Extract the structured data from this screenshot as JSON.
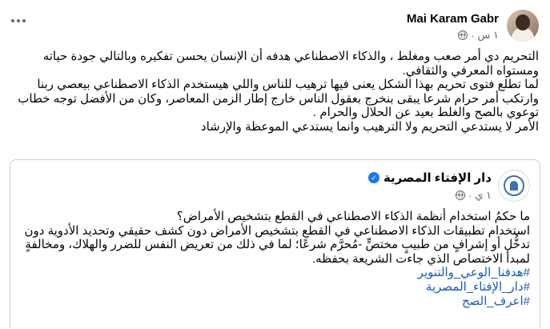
{
  "post": {
    "author": "Mai Karam Gabr",
    "time": "١ س",
    "more_icon": "ellipsis-icon",
    "privacy_icon": "globe-icon",
    "paragraphs": [
      "التحريم دي أمر صعب ومغلط ، والذكاء الاصطناعي هدفه أن الإنسان يحسن تفكيره وبالتالي جودة حياته ومستواه المعرفي والثقافي.",
      "لما تطلع فتوى تحريم بهذا الشكل يعنى فيها ترهيب للناس واللي هيستخدم الذكاء الاصطناعي بيعصي ربنا وارتكب أمر حرام شرعا يبقى بنخرج بعقول الناس خارج إطار الزمن المعاصر، وكان من الأفضل توجه خطاب توعوي بالصح والغلط بعيد عن الحلال والحرام .",
      "الأمر لا يستدعي التحريم ولا الترهيب وانما يستدعي الموعظة والإرشاد"
    ]
  },
  "shared": {
    "page_name": "دار الإفتاء المصرية",
    "time": "١ ي",
    "verified_icon": "verified-badge-icon",
    "privacy_icon": "globe-icon",
    "question": "ما حكمُ استخدام أنظمة الذكاء الاصطناعي في القطع بتشخيص الأمراض؟",
    "answer": "استخدام تطبيقات الذكاء الاصطناعي في القطع بتشخيص الأمراض دون كشف حقيقي وتحديد الأدوية دون تدخُّل أو إشرافٍ من طبيبٍ مختصٍّ -مُحرَّم شرعًا؛ لما في ذلك من تعريض النفس للضرر والهلاك، ومخالفةٍ لمبدأ الاختصاص الذي جاءت الشريعة بحفظه.",
    "hashtags": [
      "#هدفنا_الوعي_والتنوير",
      "#دار_الإفتاء_المصرية",
      "#اعرف_الصح"
    ]
  }
}
